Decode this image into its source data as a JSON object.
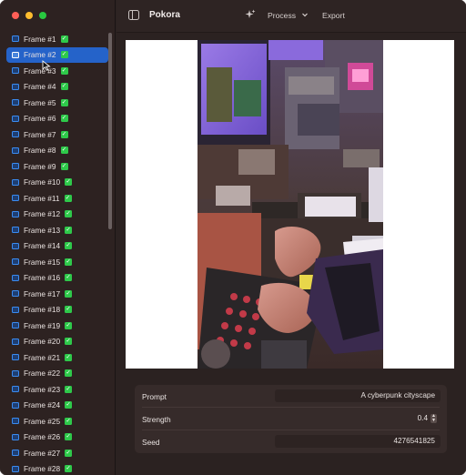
{
  "app": {
    "title": "Pokora"
  },
  "toolbar": {
    "process_label": "Process",
    "export_label": "Export"
  },
  "sidebar": {
    "frames": [
      {
        "label": "Frame #1",
        "done": true
      },
      {
        "label": "Frame #2",
        "done": true,
        "selected": true
      },
      {
        "label": "Frame #3",
        "done": true
      },
      {
        "label": "Frame #4",
        "done": true
      },
      {
        "label": "Frame #5",
        "done": true
      },
      {
        "label": "Frame #6",
        "done": true
      },
      {
        "label": "Frame #7",
        "done": true
      },
      {
        "label": "Frame #8",
        "done": true
      },
      {
        "label": "Frame #9",
        "done": true
      },
      {
        "label": "Frame #10",
        "done": true
      },
      {
        "label": "Frame #11",
        "done": true
      },
      {
        "label": "Frame #12",
        "done": true
      },
      {
        "label": "Frame #13",
        "done": true
      },
      {
        "label": "Frame #14",
        "done": true
      },
      {
        "label": "Frame #15",
        "done": true
      },
      {
        "label": "Frame #16",
        "done": true
      },
      {
        "label": "Frame #17",
        "done": true
      },
      {
        "label": "Frame #18",
        "done": true
      },
      {
        "label": "Frame #19",
        "done": true
      },
      {
        "label": "Frame #20",
        "done": true
      },
      {
        "label": "Frame #21",
        "done": true
      },
      {
        "label": "Frame #22",
        "done": true
      },
      {
        "label": "Frame #23",
        "done": true
      },
      {
        "label": "Frame #24",
        "done": true
      },
      {
        "label": "Frame #25",
        "done": true
      },
      {
        "label": "Frame #26",
        "done": true
      },
      {
        "label": "Frame #27",
        "done": true
      },
      {
        "label": "Frame #28",
        "done": true
      }
    ]
  },
  "settings": {
    "prompt_label": "Prompt",
    "prompt_value": "A cyberpunk cityscape",
    "strength_label": "Strength",
    "strength_value": "0.4",
    "seed_label": "Seed",
    "seed_value": "4276541825"
  },
  "colors": {
    "accent": "#2563c9",
    "check": "#2ec94a",
    "window_bg": "#2b2221"
  },
  "icons": {
    "sidebar_toggle": "sidebar-toggle-icon",
    "process": "sparkle-icon",
    "process_menu": "chevron-down-icon",
    "frame": "image-frame-icon",
    "done": "checkmark-icon"
  }
}
